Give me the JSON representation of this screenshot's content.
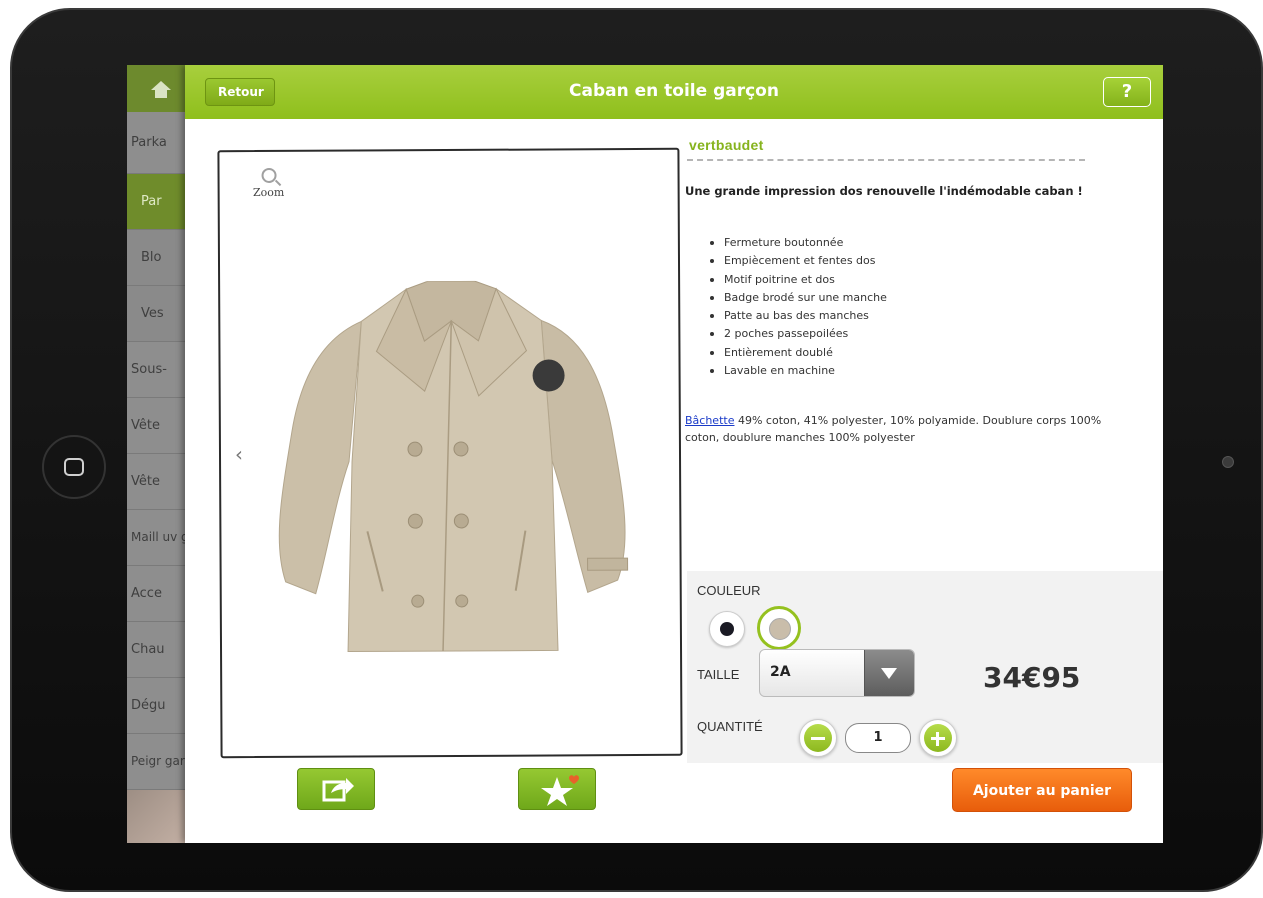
{
  "sidebar": {
    "items": [
      {
        "label": "Parka"
      },
      {
        "label": "Par"
      },
      {
        "label": "Blo"
      },
      {
        "label": "Ves"
      },
      {
        "label": "Sous-"
      },
      {
        "label": "Vête"
      },
      {
        "label": "Vête"
      },
      {
        "label": "Maill uv ga"
      },
      {
        "label": "Acce"
      },
      {
        "label": "Chau"
      },
      {
        "label": "Dégu"
      },
      {
        "label": "Peigr garç"
      }
    ]
  },
  "topbar": {
    "back_label": "Retour",
    "title": "Caban en toile garçon",
    "help_label": "?"
  },
  "gallery": {
    "zoom_label": "Zoom",
    "prev_arrow": "‹"
  },
  "product": {
    "brand": "vertbaudet",
    "headline": "Une grande impression dos renouvelle l'indémodable caban !",
    "features": [
      "Fermeture boutonnée",
      "Empiècement et fentes dos",
      "Motif poitrine et dos",
      "Badge brodé sur une manche",
      "Patte au bas des manches",
      "2 poches passepoilées",
      "Entièrement doublé",
      "Lavable en machine"
    ],
    "material_link": "Bâchette",
    "composition": " 49% coton, 41% polyester, 10% polyamide. Doublure corps 100% coton, doublure manches 100% polyester"
  },
  "options": {
    "color_label": "COULEUR",
    "colors": [
      "#1a1a24",
      "#c9bdaa"
    ],
    "selected_color": 1,
    "size_label": "TAILLE",
    "size_value": "2A",
    "quantity_label": "QUANTITÉ",
    "quantity_value": "1",
    "price": "34€95"
  },
  "actions": {
    "add_to_cart": "Ajouter au panier"
  },
  "colors": {
    "accent_green": "#95c11f",
    "cart_orange": "#f07015"
  }
}
